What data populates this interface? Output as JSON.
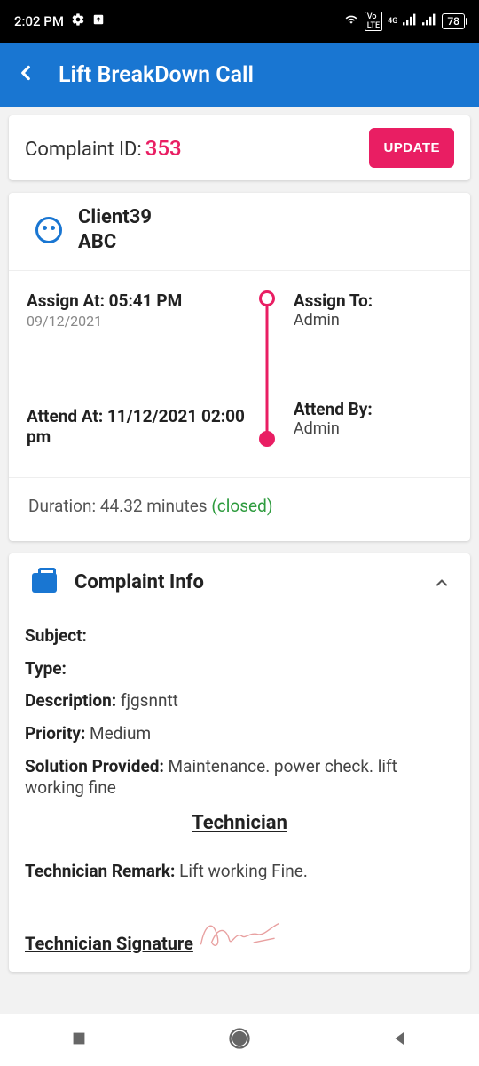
{
  "status": {
    "time": "2:02 PM",
    "battery": "78"
  },
  "app": {
    "title": "Lift BreakDown Call"
  },
  "header": {
    "complaint_label": "Complaint ID:",
    "complaint_id": "353",
    "update_btn": "UPDATE"
  },
  "client": {
    "name1": "Client39",
    "name2": "ABC"
  },
  "timeline": {
    "assign_at_label": "Assign At: 05:41 PM",
    "assign_at_date": "09/12/2021",
    "assign_to_label": "Assign To:",
    "assign_to_val": "Admin",
    "attend_at_label": "Attend At: 11/12/2021 02:00 pm",
    "attend_by_label": "Attend By:",
    "attend_by_val": "Admin"
  },
  "duration": {
    "text": "Duration: 44.32 minutes",
    "status": "(closed)"
  },
  "info": {
    "title": "Complaint Info",
    "subject_label": "Subject:",
    "subject_val": "",
    "type_label": "Type:",
    "type_val": "",
    "desc_label": "Description:",
    "desc_val": "fjgsnntt",
    "priority_label": "Priority:",
    "priority_val": "Medium",
    "solution_label": "Solution Provided:",
    "solution_val": "Maintenance.   power check. lift working fine",
    "tech_header": "Technician",
    "tech_remark_label": "Technician Remark:",
    "tech_remark_val": "Lift working Fine.",
    "tech_sig_label": "Technician Signature"
  }
}
